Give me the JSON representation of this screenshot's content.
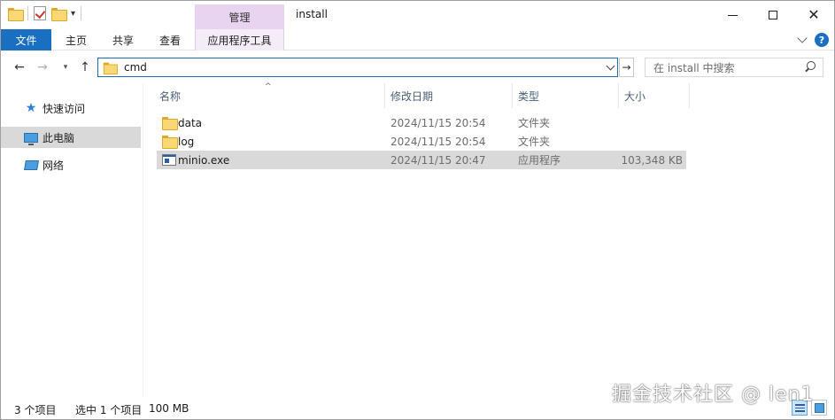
{
  "window": {
    "title": "install",
    "context_tab": "管理"
  },
  "ribbon": {
    "tabs": [
      "文件",
      "主页",
      "共享",
      "查看",
      "应用程序工具"
    ],
    "active_color": "#1a6fc0",
    "context_color": "#e8d3f0"
  },
  "address": {
    "path": "cmd",
    "search_placeholder": "在 install 中搜索"
  },
  "nav_pane": {
    "items": [
      {
        "label": "快速访问",
        "icon": "star-icon"
      },
      {
        "label": "此电脑",
        "icon": "computer-icon",
        "selected": true
      },
      {
        "label": "网络",
        "icon": "network-icon"
      }
    ]
  },
  "columns": {
    "name": "名称",
    "date": "修改日期",
    "type": "类型",
    "size": "大小"
  },
  "files": [
    {
      "name": "data",
      "date": "2024/11/15 20:54",
      "type": "文件夹",
      "size": "",
      "icon": "folder-icon"
    },
    {
      "name": "log",
      "date": "2024/11/15 20:54",
      "type": "文件夹",
      "size": "",
      "icon": "folder-icon"
    },
    {
      "name": "minio.exe",
      "date": "2024/11/15 20:47",
      "type": "应用程序",
      "size": "103,348 KB",
      "icon": "exe-icon",
      "selected": true
    }
  ],
  "status": {
    "item_count": "3 个项目",
    "selected": "选中 1 个项目",
    "selected_size": "100 MB"
  },
  "watermark": "掘金技术社区 @ len1"
}
